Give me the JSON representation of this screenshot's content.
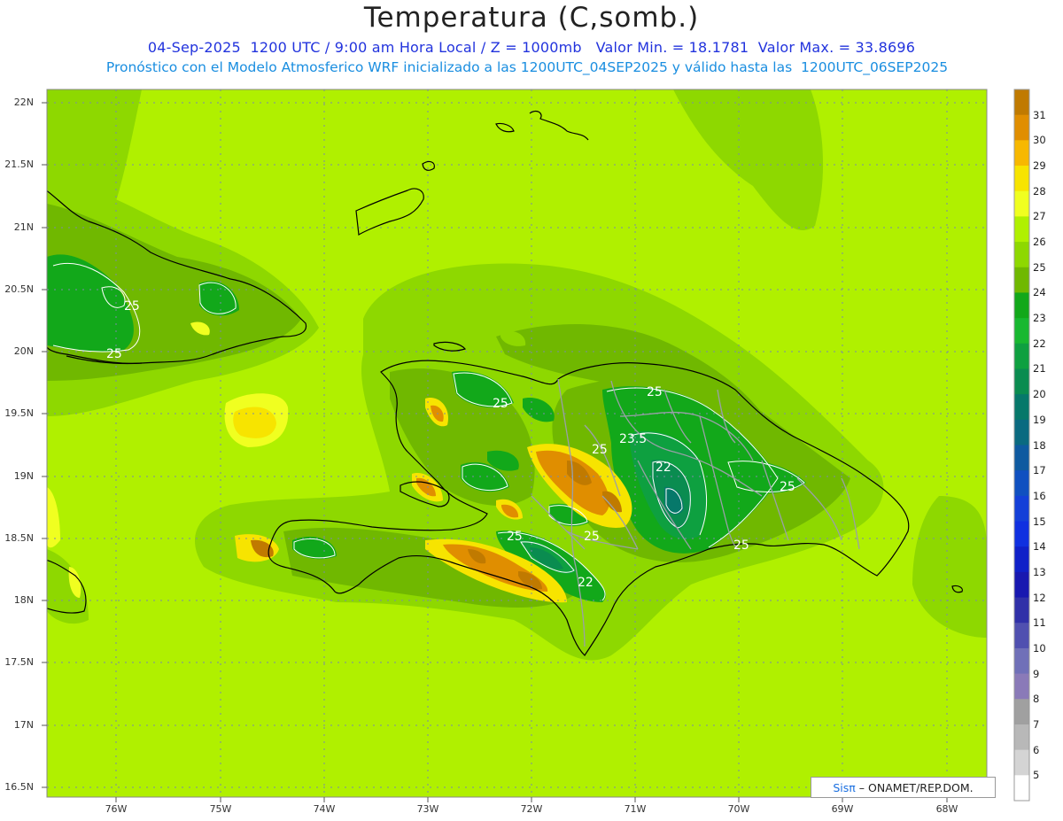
{
  "title": "Temperatura (C,somb.)",
  "subtitle_1": "04-Sep-2025  1200 UTC / 9:00 am Hora Local / Z = 1000mb   Valor Min. = 18.1781  Valor Max. = 33.8696",
  "subtitle_2": "Pronóstico con el Modelo Atmosferico WRF inicializado a las 1200UTC_04SEP2025 y válido hasta las  1200UTC_06SEP2025",
  "credit": {
    "sis": "Sisπ",
    "org": "– ONAMET/REP.DOM."
  },
  "axes": {
    "y_ticks": [
      "22N",
      "21.5N",
      "21N",
      "20.5N",
      "20N",
      "19.5N",
      "19N",
      "18.5N",
      "18N",
      "17.5N",
      "17N",
      "16.5N"
    ],
    "x_ticks": [
      "76W",
      "75W",
      "74W",
      "73W",
      "72W",
      "71W",
      "70W",
      "69W",
      "68W"
    ]
  },
  "colorbar": {
    "labels": [
      "31",
      "30",
      "29",
      "28",
      "27",
      "26",
      "25",
      "24",
      "23",
      "22",
      "21",
      "20",
      "19",
      "18",
      "17",
      "16",
      "15",
      "14",
      "13",
      "12",
      "11",
      "10",
      "9",
      "8",
      "7",
      "6",
      "5"
    ],
    "colors": [
      "#c07a00",
      "#e08e00",
      "#f7b800",
      "#f7e400",
      "#f0ff20",
      "#b0f000",
      "#8ed800",
      "#70b800",
      "#12a81a",
      "#18b830",
      "#0ea040",
      "#0a8c50",
      "#06786a",
      "#0a6a80",
      "#0e5aa0",
      "#1050c0",
      "#1440d8",
      "#1030e0",
      "#1020c8",
      "#1818b0",
      "#3030a8",
      "#5050b0",
      "#7070b8",
      "#8a7ab8",
      "#a0a0a0",
      "#b8b8b8",
      "#d4d4d4",
      "#ffffff"
    ]
  },
  "contour_labels": [
    {
      "text": "25"
    },
    {
      "text": "25"
    },
    {
      "text": "25"
    },
    {
      "text": "25"
    },
    {
      "text": "23.5"
    },
    {
      "text": "22"
    },
    {
      "text": "25"
    },
    {
      "text": "25"
    },
    {
      "text": "25"
    },
    {
      "text": "25"
    },
    {
      "text": "25"
    },
    {
      "text": "22"
    }
  ],
  "colors": {
    "background_field": "#b0f000",
    "land_26": "#8ed800",
    "zone_25": "#70b800",
    "zone_24": "#12a81a",
    "zone_23": "#0ea040",
    "zone_22": "#0a8c50",
    "zone_21": "#06786a",
    "warm_28": "#f0ff20",
    "warm_29": "#f7e400",
    "warm_30": "#e08e00",
    "warm_31": "#c07a00",
    "coast": "#000000",
    "borders": "#9aa0a8",
    "grid": "#7a8aa8"
  }
}
